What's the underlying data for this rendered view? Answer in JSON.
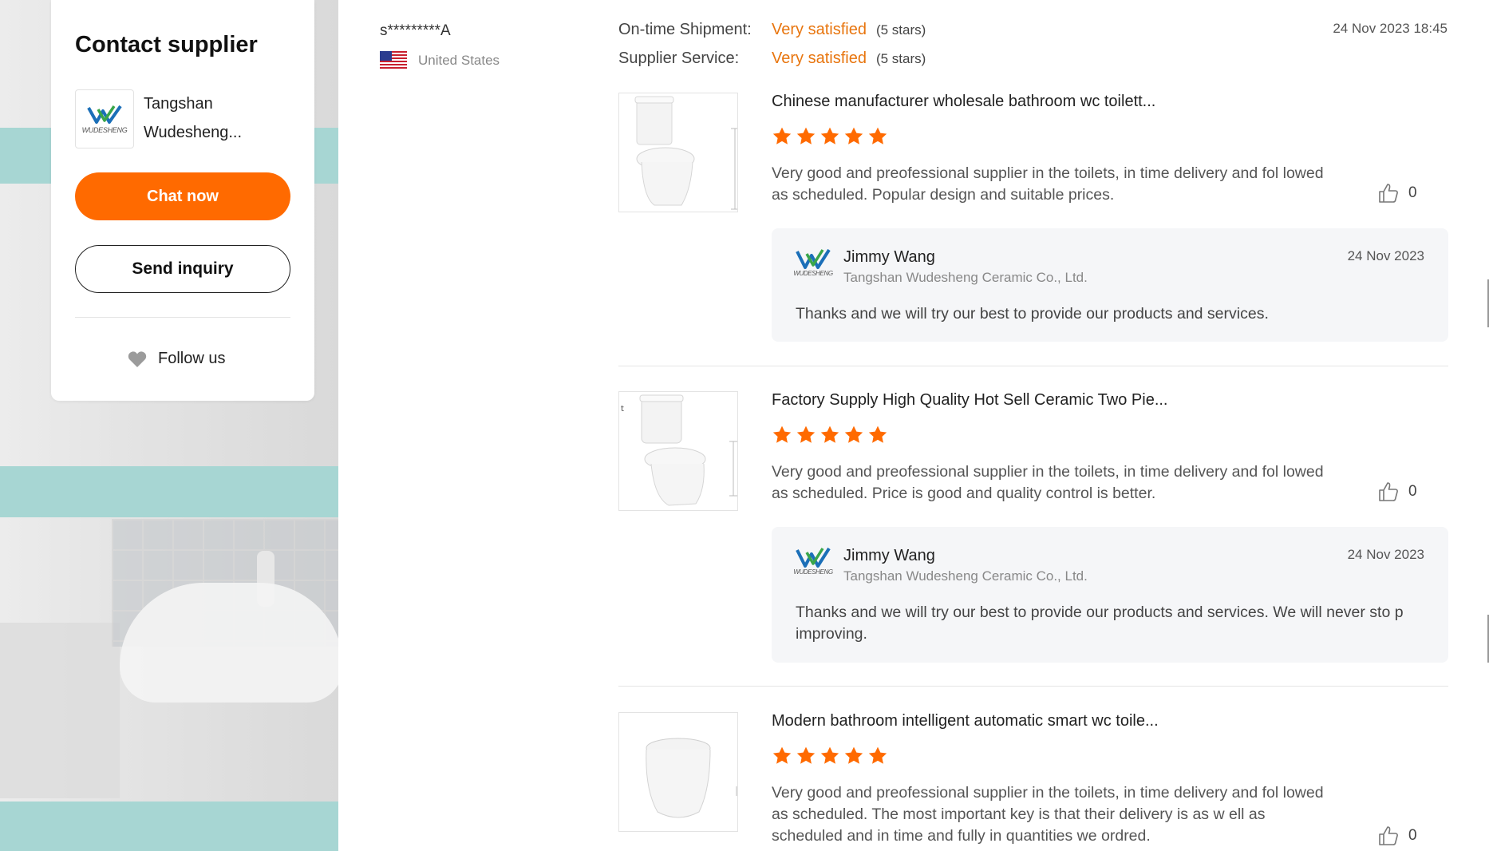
{
  "contact": {
    "title": "Contact supplier",
    "supplier_name": "Tangshan Wudesheng...",
    "logo_text": "WUDESHENG",
    "chat_label": "Chat now",
    "inquiry_label": "Send inquiry",
    "follow_label": "Follow us"
  },
  "reviewer": {
    "name": "s*********A",
    "country": "United States",
    "date": "24 Nov 2023 18:45"
  },
  "ratings": [
    {
      "label": "On-time Shipment:",
      "value": "Very satisfied",
      "stars": "(5 stars)"
    },
    {
      "label": "Supplier Service:",
      "value": "Very satisfied",
      "stars": "(5 stars)"
    }
  ],
  "colors": {
    "accent": "#ff6a00",
    "star": "#ff6a00",
    "satisfied": "#e8750e"
  },
  "reviews": [
    {
      "title": "Chinese manufacturer wholesale bathroom wc toilett...",
      "rating": 5,
      "text": "Very good and preofessional supplier in the toilets, in time delivery and fol lowed as scheduled.  Popular design and suitable prices.",
      "likes": "0",
      "reply": {
        "name": "Jimmy Wang",
        "company": "Tangshan Wudesheng Ceramic Co., Ltd.",
        "date": "24 Nov 2023",
        "text": "Thanks and we will try our best to provide our products and services."
      }
    },
    {
      "title": "Factory Supply High Quality Hot Sell Ceramic Two Pie...",
      "rating": 5,
      "text": "Very good and preofessional supplier in the toilets, in time delivery and fol lowed as scheduled.  Price is good and quality control is better.",
      "likes": "0",
      "reply": {
        "name": "Jimmy Wang",
        "company": "Tangshan Wudesheng Ceramic Co., Ltd.",
        "date": "24 Nov 2023",
        "text": "Thanks and we will try our best to provide our products and services. We will never sto p improving."
      }
    },
    {
      "title": "Modern bathroom intelligent automatic smart wc toile...",
      "rating": 5,
      "text": "Very good and preofessional supplier in the toilets, in time delivery and fol lowed as scheduled.  The most important key is that their delivery is as w ell as scheduled and in time and fully in quantities we ordred.",
      "likes": "0"
    }
  ],
  "icons": {
    "star": "star-icon",
    "like": "thumbs-up-icon",
    "heart": "heart-icon",
    "flag": "us-flag-icon"
  }
}
